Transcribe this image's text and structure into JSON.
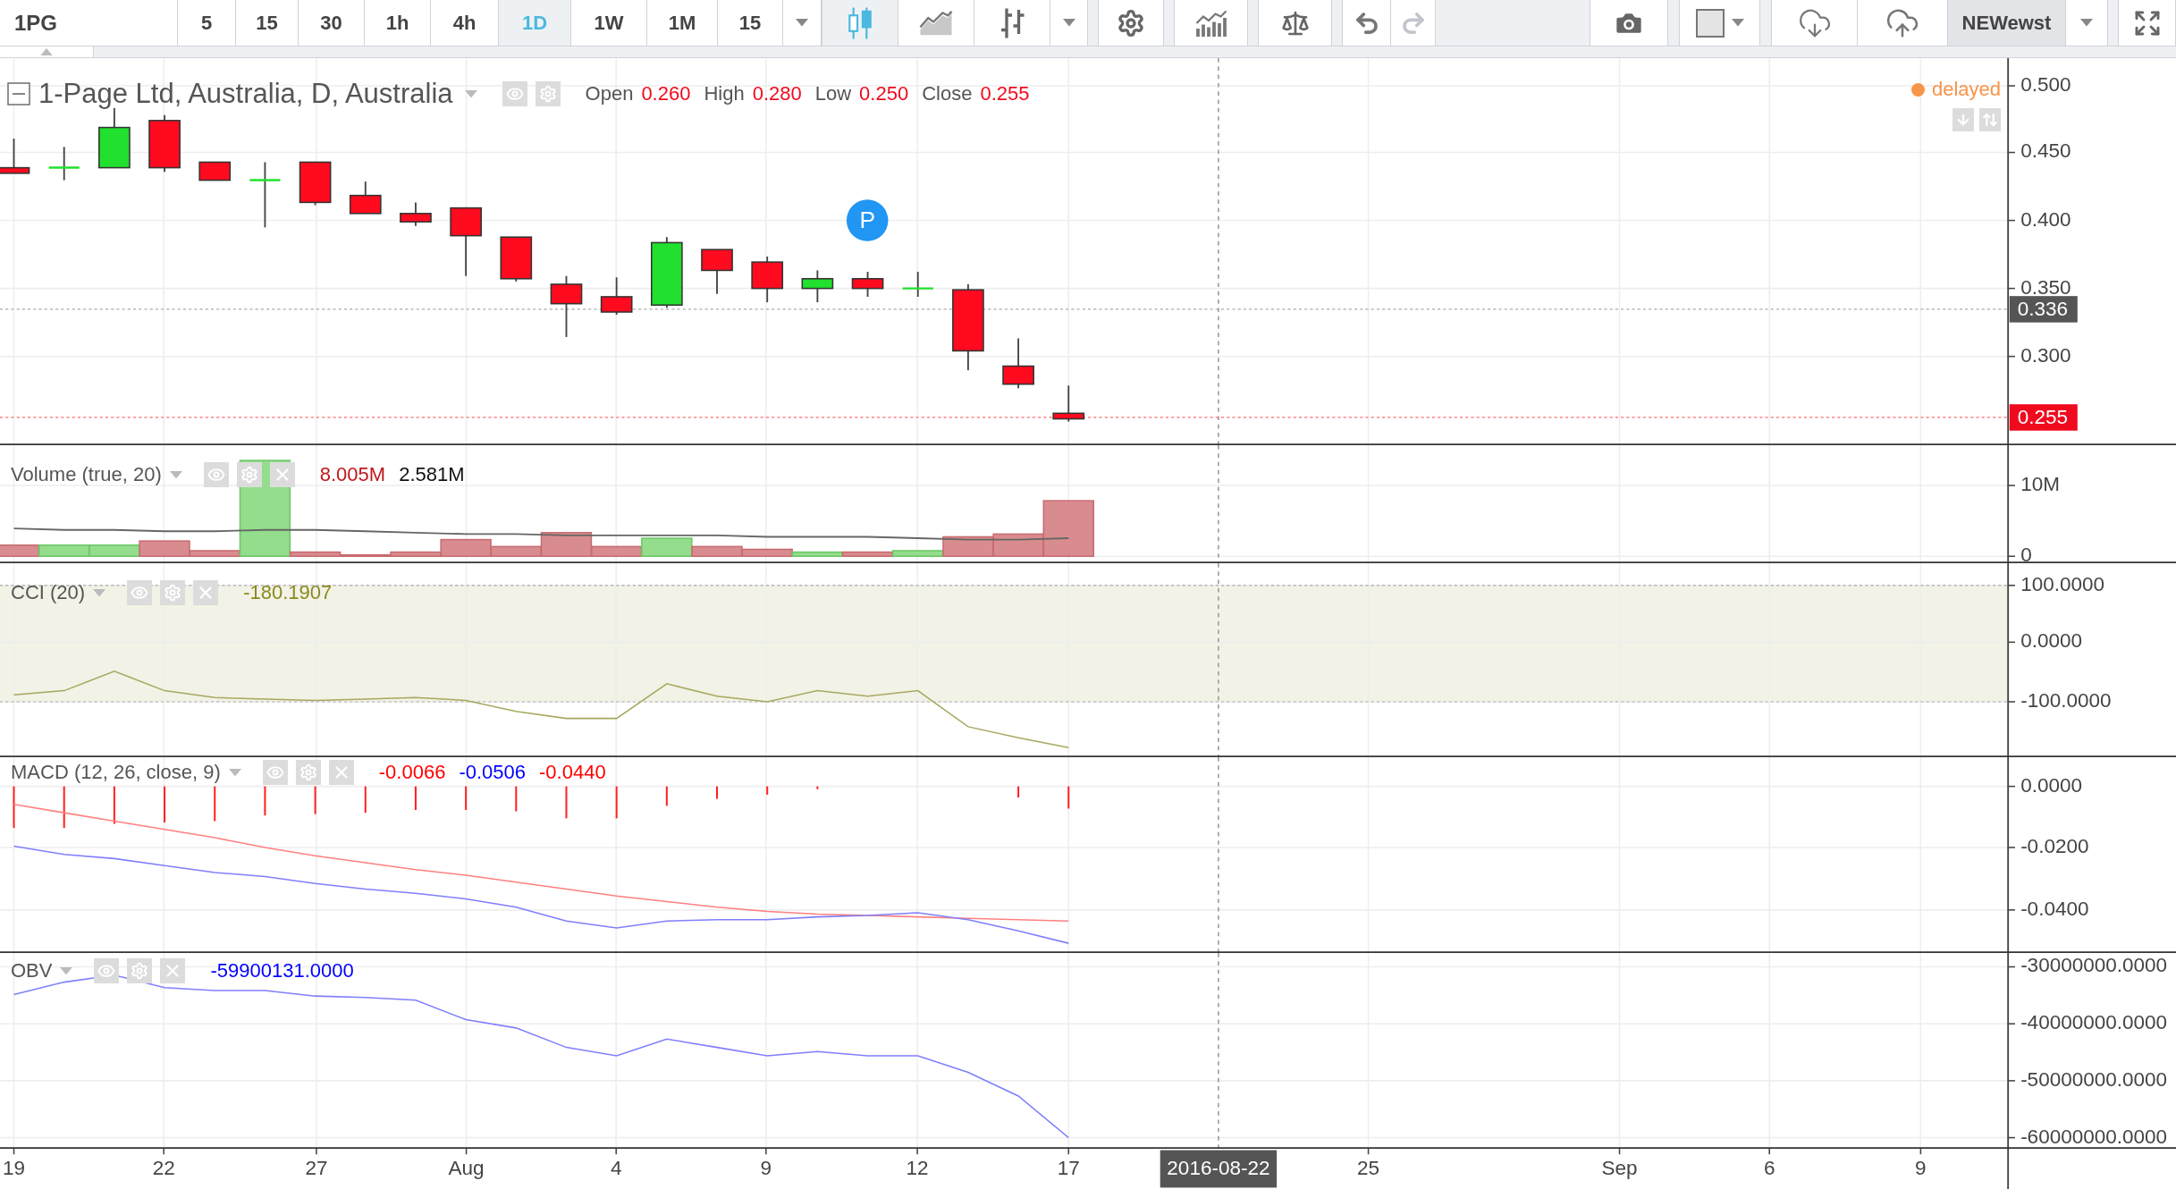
{
  "toolbar": {
    "symbol": "1PG",
    "intervals": [
      {
        "label": "5",
        "selected": false
      },
      {
        "label": "15",
        "selected": false
      },
      {
        "label": "30",
        "selected": false
      },
      {
        "label": "1h",
        "selected": false
      },
      {
        "label": "4h",
        "selected": false
      },
      {
        "label": "1D",
        "selected": true
      },
      {
        "label": "1W",
        "selected": false
      },
      {
        "label": "1M",
        "selected": false
      },
      {
        "label": "15",
        "selected": false
      }
    ],
    "chart_types": [
      {
        "kind": "candles",
        "selected": true
      },
      {
        "kind": "area",
        "selected": false
      },
      {
        "kind": "bars",
        "selected": false
      }
    ],
    "history": [
      {
        "kind": "undo",
        "disabled": false
      },
      {
        "kind": "redo",
        "disabled": true
      }
    ],
    "layout": "NEWewst"
  },
  "price_pane": {
    "title": "1-Page Ltd, Australia, D, Australia",
    "ohlc": [
      {
        "label": "Open",
        "value": "0.260"
      },
      {
        "label": "High",
        "value": "0.280"
      },
      {
        "label": "Low",
        "value": "0.250"
      },
      {
        "label": "Close",
        "value": "0.255"
      }
    ],
    "status": "delayed",
    "marker": "P",
    "axis_ticks": [
      "0.500",
      "0.450",
      "0.400",
      "0.350",
      "0.300"
    ],
    "axis_markers": [
      {
        "text": "0.336",
        "kind": "crosshair"
      },
      {
        "text": "0.255",
        "kind": "last"
      }
    ]
  },
  "indicators": [
    {
      "kind": "volume",
      "title": "Volume (true, 20)",
      "values": [
        {
          "text": "8.005M",
          "color": "#c0161b"
        },
        {
          "text": "2.581M",
          "color": "#111111"
        }
      ],
      "axis_ticks": [
        "10M",
        "0"
      ]
    },
    {
      "kind": "cci",
      "title": "CCI (20)",
      "values": [
        {
          "text": "-180.1907",
          "color": "#8a8a1e"
        }
      ],
      "axis_ticks": [
        "100.0000",
        "0.0000",
        "-100.0000"
      ]
    },
    {
      "kind": "macd",
      "title": "MACD (12, 26, close, 9)",
      "values": [
        {
          "text": "-0.0066",
          "color": "#ff0000"
        },
        {
          "text": "-0.0506",
          "color": "#0000ff"
        },
        {
          "text": "-0.0440",
          "color": "#ff0000"
        }
      ],
      "axis_ticks": [
        "0.0000",
        "-0.0200",
        "-0.0400"
      ]
    },
    {
      "kind": "obv",
      "title": "OBV",
      "values": [
        {
          "text": "-59900131.0000",
          "color": "#0000ff"
        }
      ],
      "axis_ticks": [
        "-30000000.0000",
        "-40000000.0000",
        "-50000000.0000",
        "-60000000.0000"
      ]
    }
  ],
  "time_axis": [
    {
      "text": "19",
      "kind": "date"
    },
    {
      "text": "22",
      "kind": "date"
    },
    {
      "text": "27",
      "kind": "date"
    },
    {
      "text": "Aug",
      "kind": "date"
    },
    {
      "text": "4",
      "kind": "date"
    },
    {
      "text": "9",
      "kind": "date"
    },
    {
      "text": "12",
      "kind": "date"
    },
    {
      "text": "17",
      "kind": "date"
    },
    {
      "text": "2016-08-22",
      "kind": "crosshair"
    },
    {
      "text": "25",
      "kind": "date"
    },
    {
      "text": "Sep",
      "kind": "date"
    },
    {
      "text": "6",
      "kind": "date"
    },
    {
      "text": "9",
      "kind": "date"
    }
  ]
}
